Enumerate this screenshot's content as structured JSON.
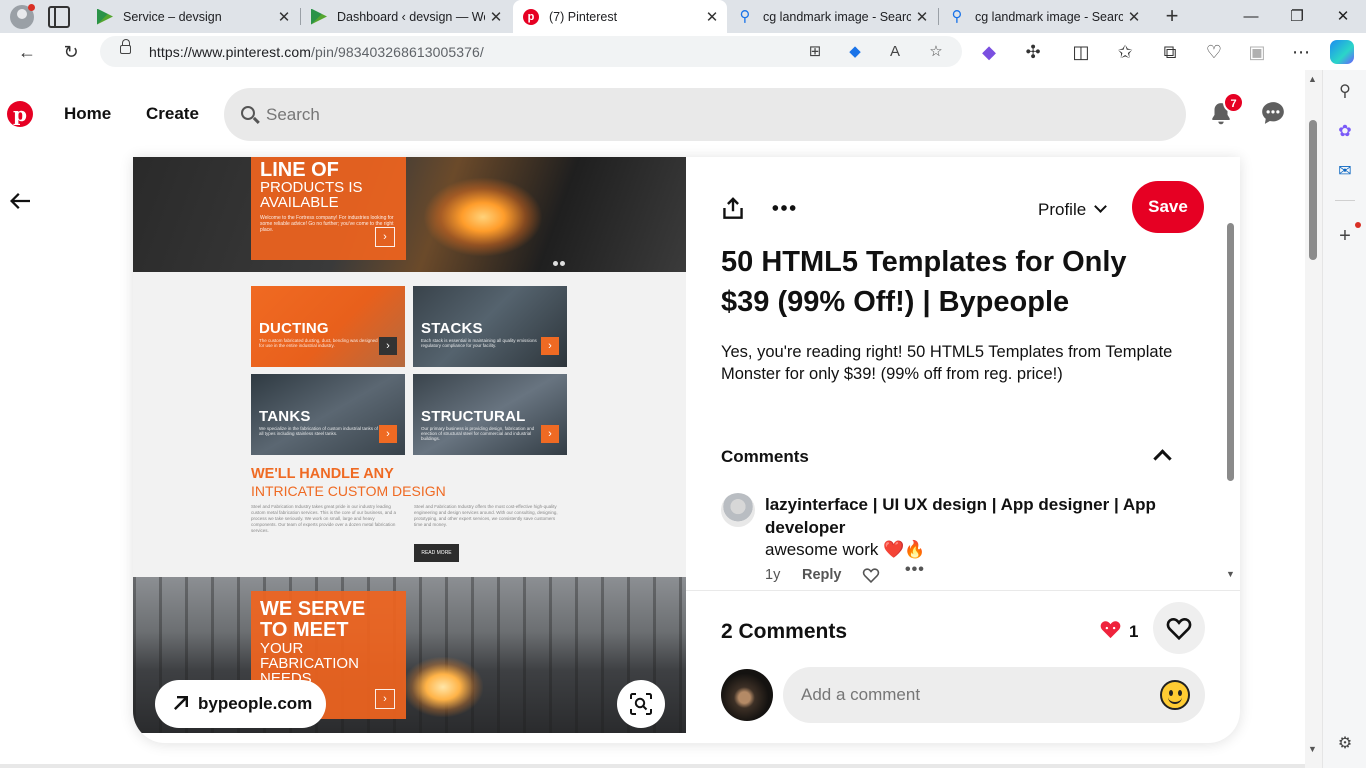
{
  "browser": {
    "tabs": [
      {
        "title": "Service – devsign",
        "favicon": "devsign-favicon",
        "active": false
      },
      {
        "title": "Dashboard ‹ devsign — Wo",
        "favicon": "devsign-favicon",
        "active": false
      },
      {
        "title": "(7) Pinterest",
        "favicon": "pinterest-favicon",
        "active": true
      },
      {
        "title": "cg landmark image - Search",
        "favicon": "search-favicon",
        "active": false
      },
      {
        "title": "cg landmark image - Search",
        "favicon": "search-favicon",
        "active": false
      }
    ],
    "url_host": "https://www.pinterest.com",
    "url_path": "/pin/983403268613005376/",
    "icons": {
      "close": "✕",
      "new_tab": "+",
      "minimize": "—",
      "restore": "❐",
      "window_close": "✕",
      "back": "←",
      "refresh": "↻",
      "more": "⋯"
    }
  },
  "pinterest": {
    "nav": {
      "home": "Home",
      "create": "Create"
    },
    "search": {
      "placeholder": "Search"
    },
    "notifications_count": "7"
  },
  "pin": {
    "image": {
      "hero_title": "Line of",
      "hero_subtitle": "Products is available",
      "hero_text": "Welcome to the Fortress company! For industries looking for some reliable advice! Go no further; you've come to the right place.",
      "tiles": [
        {
          "name": "Ducting",
          "text": "The custom fabricated ducting, duct, bending was designed for use in the entire industrial industry."
        },
        {
          "name": "Stacks",
          "text": "Each stack is essential in maintaining all quality emissions regulatory compliance for your facility."
        },
        {
          "name": "Tanks",
          "text": "We specialize in the fabrication of custom industrial tanks of all types including stainless steel tanks."
        },
        {
          "name": "Structural",
          "text": "Our primary business is providing design, fabrication and erection of structural steel for commercial and industrial buildings."
        }
      ],
      "handle_line1": "We'll handle any",
      "handle_line2": "intricate custom design",
      "para_left": "Steel and Fabrication Industry takes great pride in our industry leading custom metal fabrication services. This is the core of our business, and a process we take seriously. We work on small, large and heavy components. Our team of experts provide over a dozen metal fabrication services.",
      "para_right": "Steel and Fabrication Industry offers the most cost-effective high-quality engineering and design services around. With our consulting, designing, prototyping, and other expert services, we consistently save customers time and money.",
      "read_more": "Read more",
      "serve_line1": "We serve",
      "serve_line2": "to meet",
      "serve_line3": "your fabrication",
      "serve_line4": "needs",
      "source_link": "bypeople.com"
    },
    "profile_label": "Profile",
    "save_label": "Save",
    "title": "50 HTML5 Templates for Only $39 (99% Off!) | Bypeople",
    "description": "Yes, you're reading right! 50 HTML5 Templates from Template Monster for only $39! (99% off from reg. price!)",
    "comments_heading": "Comments",
    "comment": {
      "author": "lazyinterface | UI UX design | App designer | App developer",
      "text": "awesome work ❤️🔥",
      "age": "1y",
      "reply": "Reply"
    },
    "comment_count_label": "2 Comments",
    "reactions_count": "1",
    "add_comment_placeholder": "Add a comment"
  },
  "colors": {
    "pinterest_red": "#e60023",
    "template_orange": "#ef6a23"
  }
}
